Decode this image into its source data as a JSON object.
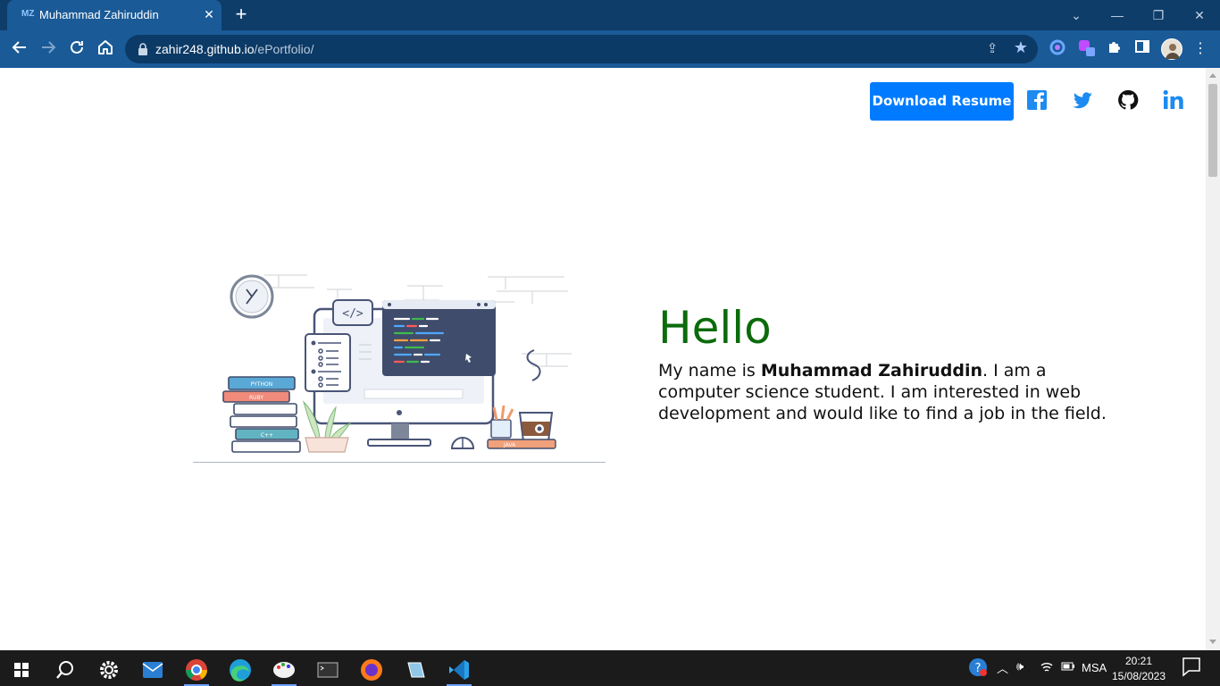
{
  "browser": {
    "tab": {
      "title": "Muhammad Zahiruddin",
      "favicon_text": "MZ"
    },
    "url_host": "zahir248.github.io",
    "url_path": "/ePortfolio/"
  },
  "page": {
    "download_label": "Download Resume",
    "hello": "Hello",
    "intro_prefix": "My name is ",
    "intro_name": "Muhammad Zahiruddin",
    "intro_suffix": ". I am a computer science student. I am interested in web development and would like to find a job in the field.",
    "illustration_labels": [
      "PYTHON",
      "RUBY",
      "C++",
      "JAVA"
    ],
    "code_tag": "</>"
  },
  "taskbar": {
    "language": "MSA",
    "time": "20:21",
    "date": "15/08/2023"
  },
  "colors": {
    "chrome_dark": "#0e3d6a",
    "chrome_tab": "#1a5a97",
    "button_blue": "#007bff",
    "hello_green": "#0b6b0b",
    "social_blue": "#1d8bf1"
  }
}
